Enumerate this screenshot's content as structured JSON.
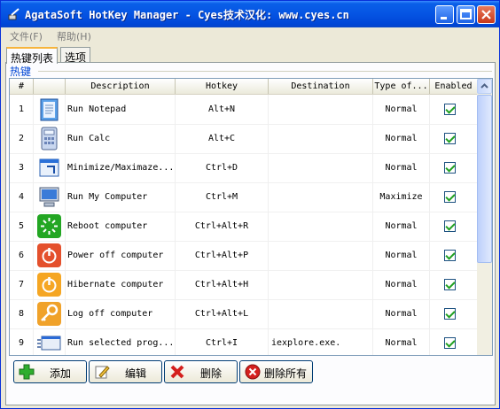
{
  "window": {
    "title": "AgataSoft HotKey Manager  -  Cyes技术汉化: www.cyes.cn",
    "accent": "#0554e3"
  },
  "menu": [
    "文件(F)",
    "帮助(H)"
  ],
  "tabs": [
    {
      "label": "热键列表",
      "active": true
    },
    {
      "label": "选项",
      "active": false
    }
  ],
  "group": {
    "label": "热键"
  },
  "table": {
    "columns": [
      "#",
      "",
      "Description",
      "Hotkey",
      "Destination",
      "Type of...",
      "Enabled"
    ],
    "rows": [
      {
        "num": "1",
        "icon": "notepad-icon",
        "desc": "Run Notepad",
        "hotkey": "Alt+N",
        "dest": "",
        "type": "Normal",
        "enabled": true
      },
      {
        "num": "2",
        "icon": "calculator-icon",
        "desc": "Run Calc",
        "hotkey": "Alt+C",
        "dest": "",
        "type": "Normal",
        "enabled": true
      },
      {
        "num": "3",
        "icon": "window-resize-icon",
        "desc": "Minimize/Maximaze...",
        "hotkey": "Ctrl+D",
        "dest": "",
        "type": "Normal",
        "enabled": true
      },
      {
        "num": "4",
        "icon": "my-computer-icon",
        "desc": "Run My Computer",
        "hotkey": "Ctrl+M",
        "dest": "",
        "type": "Maximize",
        "enabled": true
      },
      {
        "num": "5",
        "icon": "reboot-icon",
        "desc": "Reboot computer",
        "hotkey": "Ctrl+Alt+R",
        "dest": "",
        "type": "Normal",
        "enabled": true
      },
      {
        "num": "6",
        "icon": "power-off-icon",
        "desc": "Power off computer",
        "hotkey": "Ctrl+Alt+P",
        "dest": "",
        "type": "Normal",
        "enabled": true
      },
      {
        "num": "7",
        "icon": "hibernate-icon",
        "desc": "Hibernate computer",
        "hotkey": "Ctrl+Alt+H",
        "dest": "",
        "type": "Normal",
        "enabled": true
      },
      {
        "num": "8",
        "icon": "log-off-key-icon",
        "desc": "Log off computer",
        "hotkey": "Ctrl+Alt+L",
        "dest": "",
        "type": "Normal",
        "enabled": true
      },
      {
        "num": "9",
        "icon": "run-program-icon",
        "desc": "Run selected prog...",
        "hotkey": "Ctrl+I",
        "dest": "iexplore.exe.",
        "type": "Normal",
        "enabled": true
      }
    ]
  },
  "buttons": {
    "add": "添加",
    "edit": "编辑",
    "delete": "删除",
    "delete_all": "删除所有"
  }
}
